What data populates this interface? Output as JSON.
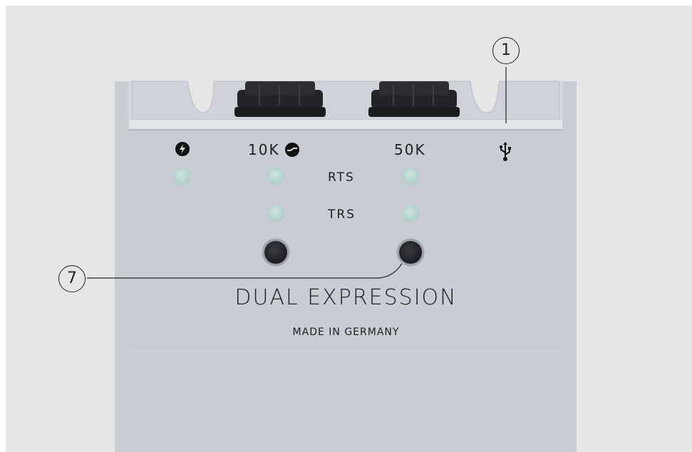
{
  "device": {
    "name": "DUAL EXPRESSION",
    "origin": "MADE IN GERMANY",
    "header_labels": {
      "power_icon": "power-lightning-icon",
      "col_10k": "10K",
      "col_10k_icon": "curve-polarity-icon",
      "col_50k": "50K",
      "usb_icon": "usb-icon"
    },
    "row_labels": {
      "rts": "RTS",
      "trs": "TRS"
    }
  },
  "callouts": {
    "c1": "1",
    "c7": "7"
  },
  "colors": {
    "panel": "#c8ccd3",
    "led": "#b5d6cd",
    "button": "#1c1d20",
    "background": "#e6e6e6"
  }
}
